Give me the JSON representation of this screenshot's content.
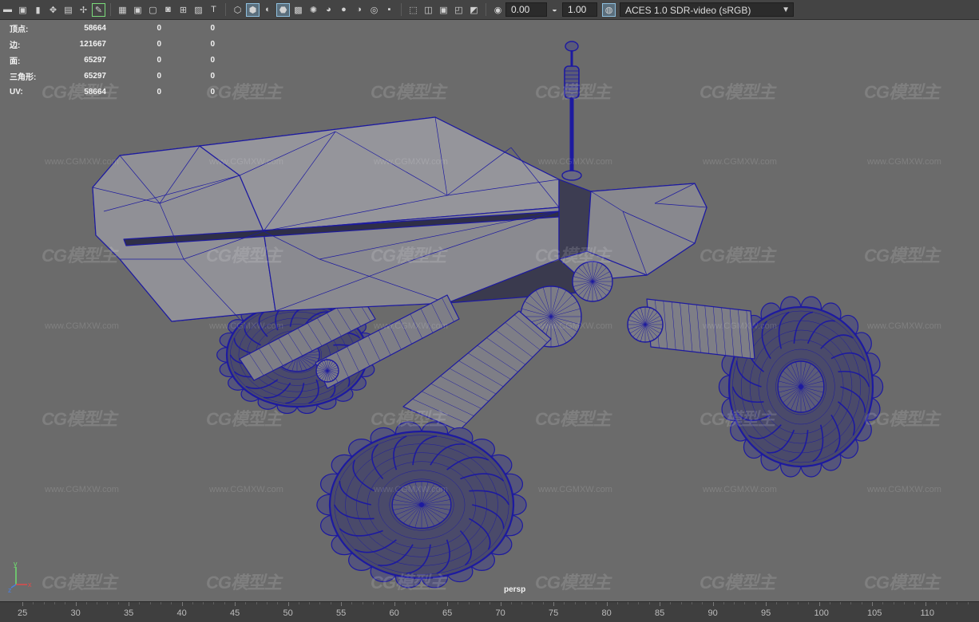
{
  "toolbar": {
    "exposure_value": "0.00",
    "gamma_value": "1.00",
    "color_management": "ACES 1.0 SDR-video (sRGB)",
    "icons": [
      "camera-attributes-icon",
      "film-gate-icon",
      "bookmark-icon",
      "camera-tools-icon",
      "image-plane-icon",
      "move-tool-icon",
      "grease-pencil-icon",
      "grid-icon",
      "film-gate-icon",
      "resolution-gate-icon",
      "gate-mask-icon",
      "field-chart-icon",
      "safe-action-icon",
      "safe-title-icon",
      "wireframe-icon",
      "smooth-shade-icon",
      "use-default-material-icon",
      "wireframe-on-shaded-icon",
      "textured-icon",
      "lights-icon",
      "shadows-icon",
      "screen-space-ao-icon",
      "motion-blur-icon",
      "anti-aliasing-icon",
      "depth-of-field-icon",
      "isolate-select-icon",
      "xray-icon",
      "xray-active-icon",
      "xray-joints-icon",
      "backface-culling-icon",
      "exposure-icon",
      "gamma-icon",
      "view-transform-icon"
    ]
  },
  "hud": {
    "rows": [
      {
        "label": "顶点:",
        "v1": "58664",
        "v2": "0",
        "v3": "0"
      },
      {
        "label": "边:",
        "v1": "121667",
        "v2": "0",
        "v3": "0"
      },
      {
        "label": "面:",
        "v1": "65297",
        "v2": "0",
        "v3": "0"
      },
      {
        "label": "三角形:",
        "v1": "65297",
        "v2": "0",
        "v3": "0"
      },
      {
        "label": "UV:",
        "v1": "58664",
        "v2": "0",
        "v3": "0"
      }
    ]
  },
  "watermark": {
    "logo": "CG模型主",
    "url": "www.CGMXW.com"
  },
  "viewport": {
    "camera": "persp",
    "axis": {
      "x": "x",
      "y": "y",
      "z": "z"
    },
    "wire_color": "#1d1aa0",
    "background": "#6b6b6b"
  },
  "timeline": {
    "ticks": [
      "25",
      "30",
      "35",
      "40",
      "45",
      "50",
      "55",
      "60",
      "65",
      "70",
      "75",
      "80",
      "85",
      "90",
      "95",
      "100",
      "105",
      "110"
    ]
  }
}
